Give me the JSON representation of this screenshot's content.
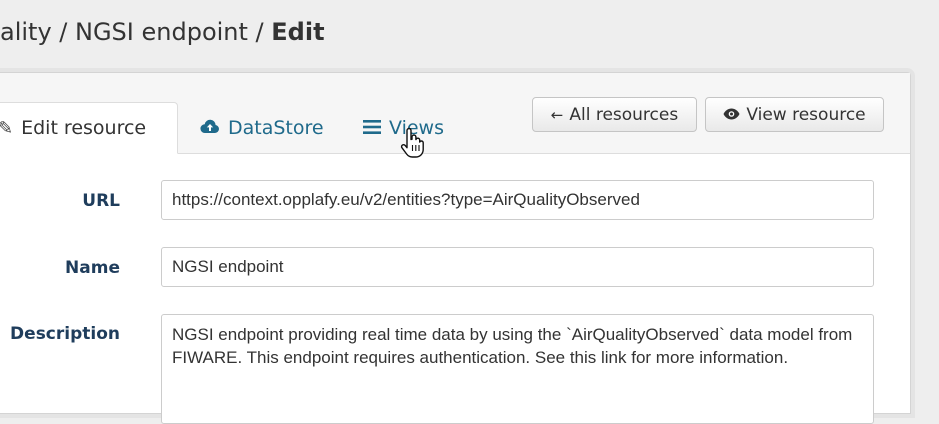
{
  "breadcrumb": {
    "prefix": "ality / NGSI endpoint / ",
    "current": "Edit"
  },
  "tabs": [
    {
      "label": "Edit resource",
      "icon": "edit-icon",
      "active": true
    },
    {
      "label": "DataStore",
      "icon": "cloud-upload-icon",
      "active": false
    },
    {
      "label": "Views",
      "icon": "list-icon",
      "active": false
    }
  ],
  "actions": {
    "all_resources_label": "All resources",
    "all_resources_icon": "arrow-left-icon",
    "view_resource_label": "View resource",
    "view_resource_icon": "eye-icon"
  },
  "form": {
    "url_label": "URL",
    "url_value": "https://context.opplafy.eu/v2/entities?type=AirQualityObserved",
    "name_label": "Name",
    "name_value": "NGSI endpoint",
    "description_label": "Description",
    "description_value": "NGSI endpoint providing real time data by using the `AirQualityObserved` data model from FIWARE. This endpoint requires authentication. See this link for more information."
  },
  "colors": {
    "link": "#1f6a8b",
    "label": "#1f3d5c",
    "background": "#eeeeee"
  }
}
